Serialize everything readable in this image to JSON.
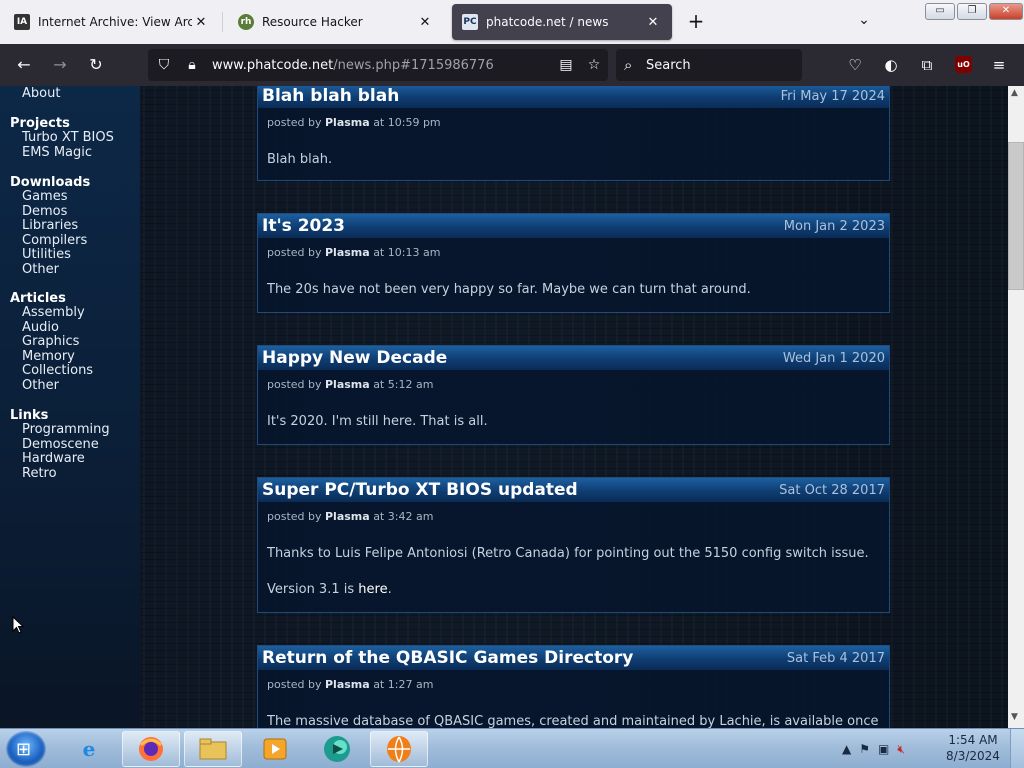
{
  "browser": {
    "tabs": [
      {
        "title": "Internet Archive: View Archive",
        "favicon": "IA",
        "active": false
      },
      {
        "title": "Resource Hacker",
        "favicon": "rh",
        "active": false
      },
      {
        "title": "phatcode.net / news",
        "favicon": "PC",
        "active": true
      }
    ],
    "url_host": "www.phatcode.net",
    "url_path": "/news.php#1715986776",
    "search_placeholder": "Search",
    "window_buttons": {
      "minimize": "▭",
      "maximize": "❐",
      "close": "✕"
    }
  },
  "icons": {
    "back": "back-arrow-icon",
    "forward": "forward-arrow-icon",
    "reload": "reload-icon",
    "shield": "tracking-protection-icon",
    "lock": "lock-icon",
    "reader": "reader-view-icon",
    "bookmark": "star-icon",
    "search": "search-icon",
    "pocket": "pocket-icon",
    "account": "account-icon",
    "extensions": "extensions-icon",
    "ublock": "ublock-origin-icon",
    "menu": "hamburger-menu-icon"
  },
  "extension_badge": "uO",
  "sidebar": {
    "top_item": "About",
    "groups": [
      {
        "heading": "Projects",
        "items": [
          "Turbo XT BIOS",
          "EMS Magic"
        ]
      },
      {
        "heading": "Downloads",
        "items": [
          "Games",
          "Demos",
          "Libraries",
          "Compilers",
          "Utilities",
          "Other"
        ]
      },
      {
        "heading": "Articles",
        "items": [
          "Assembly",
          "Audio",
          "Graphics",
          "Memory",
          "Collections",
          "Other"
        ]
      },
      {
        "heading": "Links",
        "items": [
          "Programming",
          "Demoscene",
          "Hardware",
          "Retro"
        ]
      }
    ]
  },
  "posts": [
    {
      "title": "Blah blah blah",
      "date": "Fri May 17 2024",
      "posted_by": "posted by",
      "author": "Plasma",
      "at": "at",
      "time": "10:59 pm",
      "body": [
        "Blah blah."
      ]
    },
    {
      "title": "It's 2023",
      "date": "Mon Jan 2 2023",
      "posted_by": "posted by",
      "author": "Plasma",
      "at": "at",
      "time": "10:13 am",
      "body": [
        "The 20s have not been very happy so far. Maybe we can turn that around."
      ]
    },
    {
      "title": "Happy New Decade",
      "date": "Wed Jan 1 2020",
      "posted_by": "posted by",
      "author": "Plasma",
      "at": "at",
      "time": "5:12 am",
      "body": [
        "It's 2020. I'm still here. That is all."
      ]
    },
    {
      "title": "Super PC/Turbo XT BIOS updated",
      "date": "Sat Oct 28 2017",
      "posted_by": "posted by",
      "author": "Plasma",
      "at": "at",
      "time": "3:42 am",
      "body": [
        "Thanks to Luis Felipe Antoniosi (Retro Canada) for pointing out the 5150 config switch issue."
      ],
      "version_prefix": "Version 3.1 is",
      "version_link": "here",
      "version_suffix": "."
    },
    {
      "title": "Return of the QBASIC Games Directory",
      "date": "Sat Feb 4 2017",
      "posted_by": "posted by",
      "author": "Plasma",
      "at": "at",
      "time": "1:27 am",
      "body": [
        "The massive database of QBASIC games, created and maintained by Lachie, is available once"
      ]
    }
  ],
  "taskbar": {
    "apps": [
      "internet-explorer-icon",
      "firefox-icon",
      "file-explorer-icon",
      "media-player-icon",
      "app-icon",
      "app-orange-icon"
    ],
    "clock_time": "1:54 AM",
    "clock_date": "8/3/2024"
  }
}
